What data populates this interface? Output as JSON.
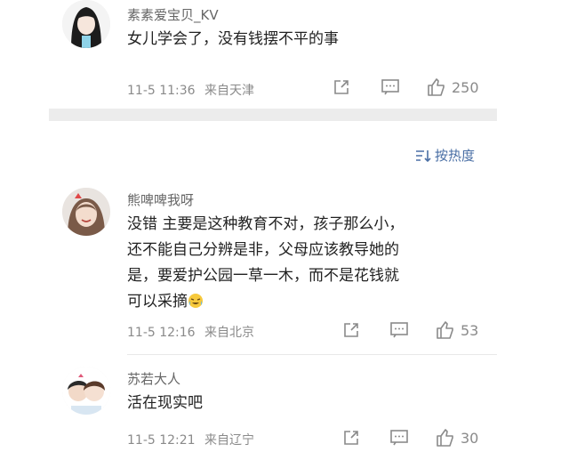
{
  "comments": [
    {
      "username": "素素爱宝贝_KV",
      "lines": [
        "女儿学会了，没有钱摆不平的事"
      ],
      "timestamp": "11-5 11:36",
      "location": "来自天津",
      "likes": "250"
    },
    {
      "username": "熊啤啤我呀",
      "lines": [
        "没错 主要是这种教育不对，孩子那么小，",
        "还不能自己分辨是非，父母应该教导她的",
        "是，要爱护公园一草一木，而不是花钱就",
        "可以采摘"
      ],
      "emoji": "laugh-cry-emoji",
      "timestamp": "11-5 12:16",
      "location": "来自北京",
      "likes": "53"
    },
    {
      "username": "苏若大人",
      "lines": [
        "活在现实吧"
      ],
      "timestamp": "11-5 12:21",
      "location": "来自辽宁",
      "likes": "30"
    }
  ],
  "sort": {
    "label": "按热度",
    "icon": "sort-icon"
  },
  "icons": {
    "share": "share-icon",
    "comment": "comment-icon",
    "like": "thumbs-up-icon"
  },
  "colors": {
    "text": "#222222",
    "meta": "#8a8a8a",
    "link": "#4a6fa5",
    "divider": "#ececec"
  }
}
